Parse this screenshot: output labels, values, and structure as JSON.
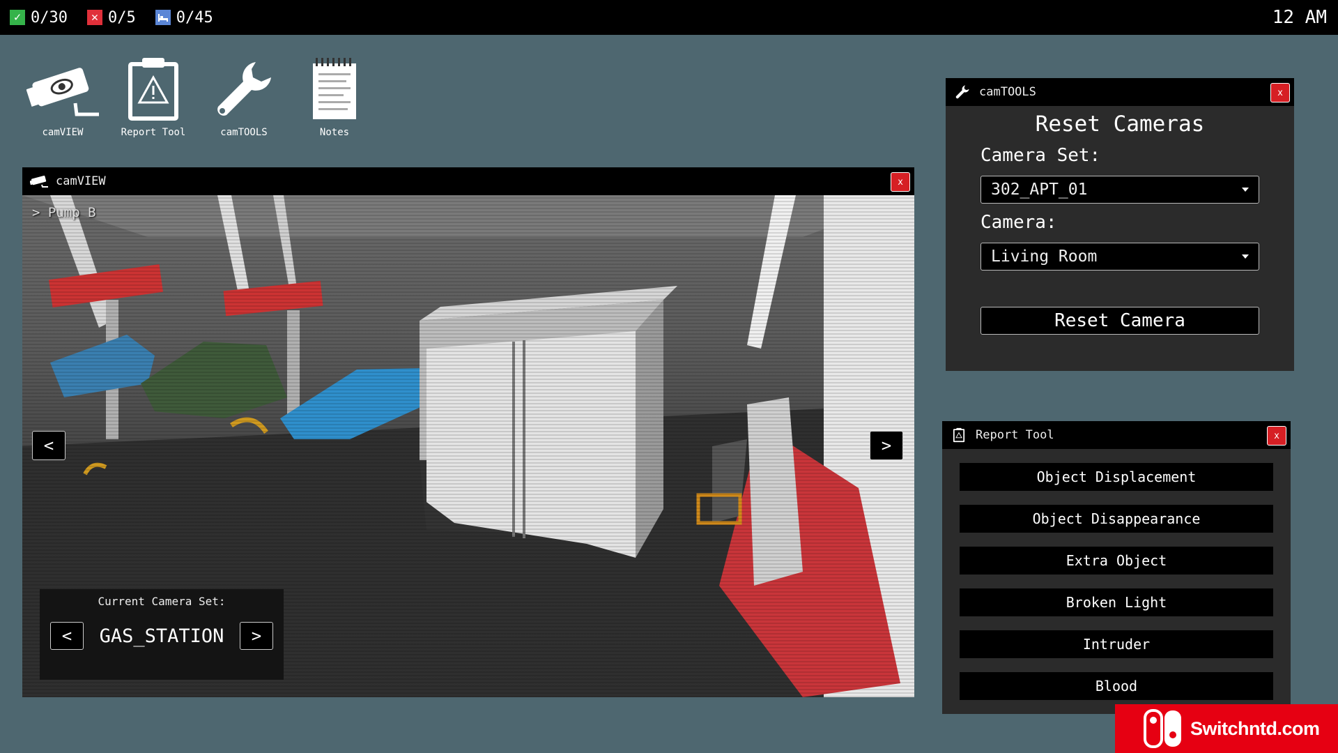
{
  "topbar": {
    "stats": [
      {
        "icon": "check-icon",
        "value": "0/30"
      },
      {
        "icon": "x-icon",
        "value": "0/5"
      },
      {
        "icon": "bed-icon",
        "value": "0/45"
      }
    ],
    "clock": "12 AM"
  },
  "desktop": {
    "icons": [
      {
        "name": "camVIEW",
        "icon": "security-camera-icon"
      },
      {
        "name": "Report Tool",
        "icon": "clipboard-warning-icon"
      },
      {
        "name": "camTOOLS",
        "icon": "wrench-icon"
      },
      {
        "name": "Notes",
        "icon": "notepad-icon"
      }
    ]
  },
  "camview": {
    "title": "camVIEW",
    "close_label": "x",
    "camera_label": "> Pump B",
    "prev_label": "<",
    "next_label": ">",
    "camera_set_title": "Current Camera Set:",
    "camera_set_name": "GAS_STATION",
    "set_prev_label": "<",
    "set_next_label": ">"
  },
  "camtools": {
    "title": "camTOOLS",
    "close_label": "x",
    "heading": "Reset Cameras",
    "camera_set_label": "Camera Set:",
    "camera_set_value": "302_APT_01",
    "camera_label": "Camera:",
    "camera_value": "Living Room",
    "reset_button": "Reset Camera"
  },
  "report": {
    "title": "Report Tool",
    "close_label": "x",
    "items": [
      "Object Displacement",
      "Object Disappearance",
      "Extra Object",
      "Broken Light",
      "Intruder",
      "Blood"
    ]
  },
  "watermark": {
    "text": "Switchntd.com",
    "color": "#e60012"
  },
  "colors": {
    "desktop_bg": "#4e6770",
    "close_red": "#d61f24",
    "check_green": "#35b34a",
    "x_red": "#e0303a",
    "bed_blue": "#5b86d6"
  }
}
